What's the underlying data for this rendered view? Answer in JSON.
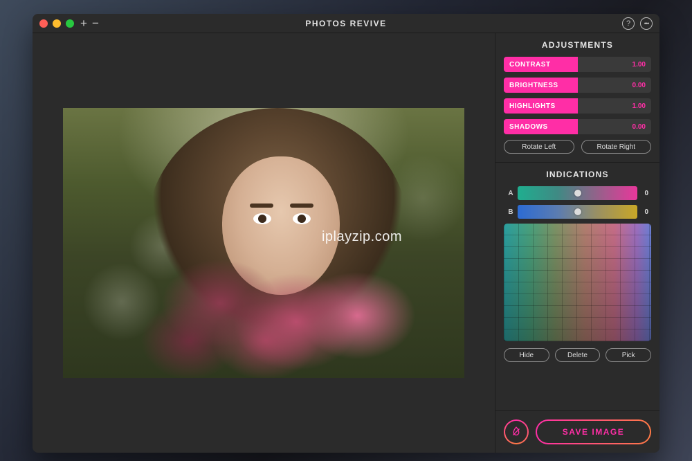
{
  "app": {
    "title": "PHOTOS REVIVE",
    "watermark": "iplayzip.com"
  },
  "titlebar": {
    "plus": "+",
    "minus": "−",
    "help": "?",
    "more": "•••"
  },
  "adjustments": {
    "title": "ADJUSTMENTS",
    "rows": [
      {
        "label": "CONTRAST",
        "value": "1.00",
        "fill": 50
      },
      {
        "label": "BRIGHTNESS",
        "value": "0.00",
        "fill": 50
      },
      {
        "label": "HIGHLIGHTS",
        "value": "1.00",
        "fill": 50
      },
      {
        "label": "SHADOWS",
        "value": "0.00",
        "fill": 50
      }
    ],
    "rotate_left": "Rotate Left",
    "rotate_right": "Rotate Right"
  },
  "indications": {
    "title": "INDICATIONS",
    "sliders": [
      {
        "label": "A",
        "value": "0",
        "pos": 50
      },
      {
        "label": "B",
        "value": "0",
        "pos": 50
      }
    ],
    "hide": "Hide",
    "delete": "Delete",
    "pick": "Pick"
  },
  "save": {
    "label": "SAVE IMAGE"
  }
}
